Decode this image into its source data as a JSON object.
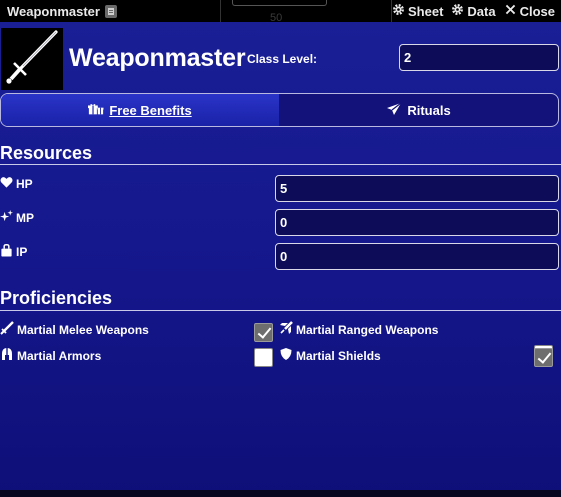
{
  "window": {
    "title": "Weaponmaster",
    "controls": [
      {
        "label": "Sheet",
        "icon": "gear-icon"
      },
      {
        "label": "Data",
        "icon": "cog-icon"
      },
      {
        "label": "Close",
        "icon": "close-icon"
      }
    ],
    "background_number": "50"
  },
  "class": {
    "name": "Weaponmaster",
    "image_icon": "sword-icon",
    "level_label": "Class Level:",
    "level_value": "2"
  },
  "tabs": [
    {
      "label": "Free Benefits",
      "icon": "gifts-icon",
      "active": true
    },
    {
      "label": "Rituals",
      "icon": "paper-plane-icon",
      "active": false
    }
  ],
  "resources": {
    "title": "Resources",
    "items": [
      {
        "label": "HP",
        "icon": "heart-icon",
        "value": "5"
      },
      {
        "label": "MP",
        "icon": "sparkles-icon",
        "value": "0"
      },
      {
        "label": "IP",
        "icon": "briefcase-icon",
        "value": "0"
      }
    ]
  },
  "proficiencies": {
    "title": "Proficiencies",
    "items": [
      {
        "label": "Martial Melee Weapons",
        "icon": "sword-icon",
        "checked": true
      },
      {
        "label": "Martial Ranged Weapons",
        "icon": "jet-icon",
        "checked": false
      },
      {
        "label": "Martial Armors",
        "icon": "helmet-icon",
        "checked": false
      },
      {
        "label": "Martial Shields",
        "icon": "shield-icon",
        "checked": true
      }
    ]
  },
  "colors": {
    "window_bg": "#1a1f96",
    "titlebar_bg": "#000000",
    "active_tab": "#2a34c8"
  }
}
